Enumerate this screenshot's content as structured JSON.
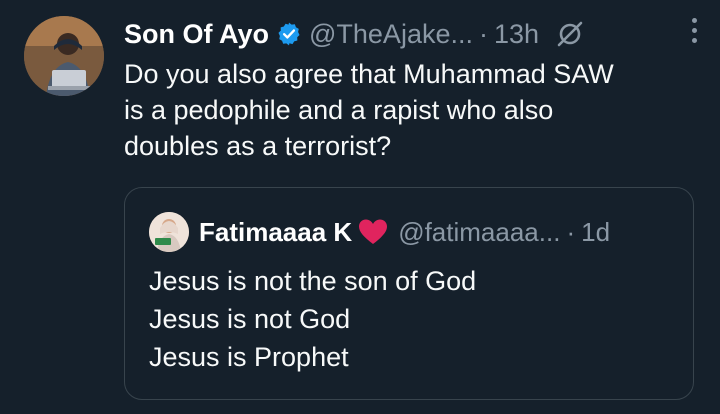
{
  "tweet": {
    "author_name": "Son Of Ayo",
    "handle": "@TheAjake...",
    "separator": "·",
    "time": "13h",
    "lines": [
      "Do you also agree that Muhammad SAW",
      "is a pedophile and a rapist who also",
      "doubles as a terrorist?"
    ]
  },
  "quoted_tweet": {
    "author_name": "Fatimaaaa K",
    "handle": "@fatimaaaa...",
    "separator": "·",
    "time": "1d",
    "lines": [
      "Jesus is not the son of God",
      "Jesus is not God",
      "Jesus is Prophet"
    ]
  },
  "icons": {
    "verified": "verified-badge-icon",
    "grok": "grok-icon",
    "more": "more-options-icon",
    "heart": "red-heart-emoji"
  },
  "colors": {
    "background": "#15202b",
    "secondary_text": "#8b98a5",
    "verified_blue": "#1d9bf0",
    "heart_red": "#e0245e",
    "border": "#38444d"
  }
}
